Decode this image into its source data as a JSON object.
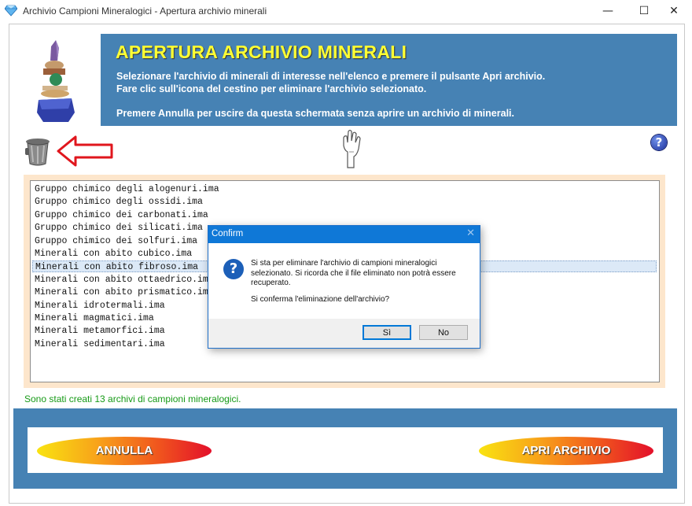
{
  "window": {
    "title": "Archivio Campioni Mineralogici - Apertura archivio minerali",
    "minimize_glyph": "—",
    "maximize_glyph": "☐",
    "close_glyph": "✕"
  },
  "header": {
    "title": "APERTURA ARCHIVIO MINERALI",
    "line1": "Selezionare l'archivio di minerali di interesse nell'elenco e premere il pulsante Apri archivio.",
    "line2": "Fare clic sull'icona del cestino per eliminare l'archivio selezionato.",
    "line3": "Premere Annulla per uscire da questa schermata senza aprire un archivio di minerali."
  },
  "help_glyph": "?",
  "list": {
    "items": [
      "Gruppo chimico degli alogenuri.ima",
      "Gruppo chimico degli ossidi.ima",
      "Gruppo chimico dei carbonati.ima",
      "Gruppo chimico dei silicati.ima",
      "Gruppo chimico dei solfuri.ima",
      "Minerali con abito cubico.ima",
      "Minerali con abito fibroso.ima",
      "Minerali con abito ottaedrico.ima",
      "Minerali con abito prismatico.ima",
      "Minerali idrotermali.ima",
      "Minerali magmatici.ima",
      "Minerali metamorfici.ima",
      "Minerali sedimentari.ima"
    ],
    "selected_index": 6
  },
  "status": "Sono stati creati 13 archivi di campioni mineralogici.",
  "buttons": {
    "cancel": "ANNULLA",
    "open": "APRI ARCHIVIO"
  },
  "dialog": {
    "title": "Confirm",
    "close_glyph": "✕",
    "icon_glyph": "?",
    "msg1": "Si sta per eliminare l'archivio di campioni mineralogici",
    "msg2": "selezionato. Si ricorda che il file eliminato non potrà essere",
    "msg3": "recuperato.",
    "msg4": "Si conferma l'eliminazione dell'archivio?",
    "yes": "Sì",
    "no": "No"
  },
  "colors": {
    "panel_blue": "#4682b4",
    "title_yellow": "#ffff33",
    "status_green": "#169a16",
    "list_bg": "#fde6cc",
    "dialog_title": "#0f78d7"
  }
}
